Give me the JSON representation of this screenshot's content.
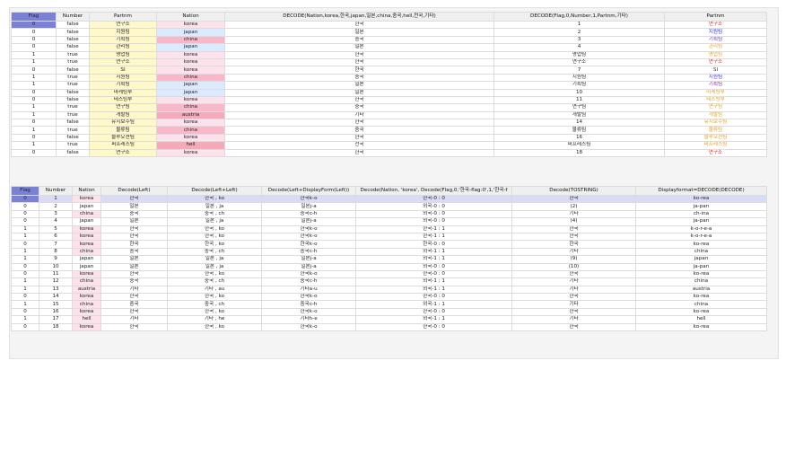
{
  "colors": {
    "selected_header": "#7b82d6",
    "partnm_bg": "#fff8c8",
    "nation_korea": "#fde2ec",
    "nation_japan": "#dbeaff",
    "nation_china": "#f8b7ca",
    "nation_austria": "#f4aab8",
    "nation_hell": "#f4aab8",
    "partnm_text": {
      "연구소": "#e02020",
      "지원팀": "#2a2adf",
      "기획팀": "#7a1fb8",
      "관리팀": "#e6a020",
      "영업팀": "#e6a020",
      "SI": "#333333",
      "마케팅부": "#e6a020",
      "테스팅부": "#e6a020",
      "연구팀": "#e6a020",
      "개발팀": "#e6a020",
      "유지보수팀": "#e6a020",
      "물류팀": "#e6a020",
      "블루오션팀": "#e6a020",
      "퍼프레스팀": "#e6a020"
    }
  },
  "grid1": {
    "columns": [
      "Flag",
      "Number",
      "Partnm",
      "Nation",
      "DECODE(Nation,korea,한국,japan,일본,china,중국,hell,천국,기타)",
      "DECODE(Flag,0,Number,1,Partnm,기타)",
      "Partnm"
    ],
    "rows": [
      [
        "0",
        "false",
        "연구소",
        "korea",
        "한국",
        "1",
        "연구소"
      ],
      [
        "0",
        "false",
        "지원팀",
        "japan",
        "일본",
        "2",
        "지원팀"
      ],
      [
        "0",
        "false",
        "기획팀",
        "china",
        "중국",
        "3",
        "기획팀"
      ],
      [
        "0",
        "false",
        "관리팀",
        "japan",
        "일본",
        "4",
        "관리팀"
      ],
      [
        "1",
        "true",
        "영업팀",
        "korea",
        "한국",
        "영업팀",
        "영업팀"
      ],
      [
        "1",
        "true",
        "연구소",
        "korea",
        "한국",
        "연구소",
        "연구소"
      ],
      [
        "0",
        "false",
        "SI",
        "korea",
        "한국",
        "7",
        "SI"
      ],
      [
        "1",
        "true",
        "지원팀",
        "china",
        "중국",
        "지원팀",
        "지원팀"
      ],
      [
        "1",
        "true",
        "기획팀",
        "japan",
        "일본",
        "기획팀",
        "기획팀"
      ],
      [
        "0",
        "false",
        "마케팅부",
        "japan",
        "일본",
        "10",
        "마케팅부"
      ],
      [
        "0",
        "false",
        "테스팅부",
        "korea",
        "한국",
        "11",
        "테스팅부"
      ],
      [
        "1",
        "true",
        "연구팀",
        "china",
        "중국",
        "연구팀",
        "연구팀"
      ],
      [
        "1",
        "true",
        "개발팀",
        "austria",
        "기타",
        "개발팀",
        "개발팀"
      ],
      [
        "0",
        "false",
        "유지보수팀",
        "korea",
        "한국",
        "14",
        "유지보수팀"
      ],
      [
        "1",
        "true",
        "물류팀",
        "china",
        "중국",
        "물류팀",
        "물류팀"
      ],
      [
        "0",
        "false",
        "블루오션팀",
        "korea",
        "한국",
        "16",
        "블루오션팀"
      ],
      [
        "1",
        "true",
        "퍼프레스팀",
        "hell",
        "천국",
        "퍼프레스팀",
        "퍼프레스팀"
      ],
      [
        "0",
        "false",
        "연구소",
        "korea",
        "한국",
        "18",
        "연구소"
      ]
    ]
  },
  "grid2": {
    "columns": [
      "Flag",
      "Number",
      "Nation",
      "Decode(Left)",
      "Decode(Left+Left)",
      "Decode(Left+DisplayForm(Left))",
      "Decode(Nation, 'korea', Decode(Flag,0,'한국-flag:0',1,'한국-f",
      "Decode(TOSTRING)",
      "Displayformat=DECODE(DECODE)"
    ],
    "rows": [
      [
        "0",
        "1",
        "korea",
        "한국",
        "한국 , ko",
        "한국k-o",
        "한국-0 : 0",
        "한국",
        "ko-rea"
      ],
      [
        "0",
        "2",
        "japan",
        "일본",
        "일본 , ja",
        "일본j-a",
        "외국-0 : 0",
        "(2)",
        "ja-pan"
      ],
      [
        "0",
        "3",
        "china",
        "중국",
        "중국 , ch",
        "중국c-h",
        "외국-0 : 0",
        "기타",
        "ch-ina"
      ],
      [
        "0",
        "4",
        "japan",
        "일본",
        "일본 , ja",
        "일본j-a",
        "외국-0 : 0",
        "(4)",
        "ja-pan"
      ],
      [
        "1",
        "5",
        "korea",
        "한국",
        "한국 , ko",
        "한국k-o",
        "한국-1 : 1",
        "한국",
        "k-o-r-e-a"
      ],
      [
        "1",
        "6",
        "korea",
        "한국",
        "한국 , ko",
        "한국k-o",
        "한국-1 : 1",
        "한국",
        "k-o-r-e-a"
      ],
      [
        "0",
        "7",
        "korea",
        "한국",
        "한국 , ko",
        "한국k-o",
        "한국-0 : 0",
        "한국",
        "ko-rea"
      ],
      [
        "1",
        "8",
        "china",
        "중국",
        "중국 , ch",
        "중국c-h",
        "외국-1 : 1",
        "기타",
        "china"
      ],
      [
        "1",
        "9",
        "japan",
        "일본",
        "일본 , ja",
        "일본j-a",
        "외국-1 : 1",
        "(9)",
        "japan"
      ],
      [
        "0",
        "10",
        "japan",
        "일본",
        "일본 , ja",
        "일본j-a",
        "외국-0 : 0",
        "(10)",
        "ja-pan"
      ],
      [
        "0",
        "11",
        "korea",
        "한국",
        "한국 , ko",
        "한국k-o",
        "한국-0 : 0",
        "한국",
        "ko-rea"
      ],
      [
        "1",
        "12",
        "china",
        "중국",
        "중국 , ch",
        "중국c-h",
        "외국-1 : 1",
        "기타",
        "china"
      ],
      [
        "1",
        "13",
        "austria",
        "기타",
        "기타 , au",
        "기타a-u",
        "외국-1 : 1",
        "기타",
        "austria"
      ],
      [
        "0",
        "14",
        "korea",
        "한국",
        "한국 , ko",
        "한국k-o",
        "한국-0 : 0",
        "한국",
        "ko-rea"
      ],
      [
        "1",
        "15",
        "china",
        "중국",
        "중국 , ch",
        "중국c-h",
        "외국-1 : 1",
        "기타",
        "china"
      ],
      [
        "0",
        "16",
        "korea",
        "한국",
        "한국 , ko",
        "한국k-o",
        "한국-0 : 0",
        "한국",
        "ko-rea"
      ],
      [
        "1",
        "17",
        "hell",
        "기타",
        "기타 , he",
        "기타h-e",
        "외국-1 : 1",
        "기타",
        "hell"
      ],
      [
        "0",
        "18",
        "korea",
        "한국",
        "한국 , ko",
        "한국k-o",
        "한국-0 : 0",
        "한국",
        "ko-rea"
      ]
    ]
  }
}
